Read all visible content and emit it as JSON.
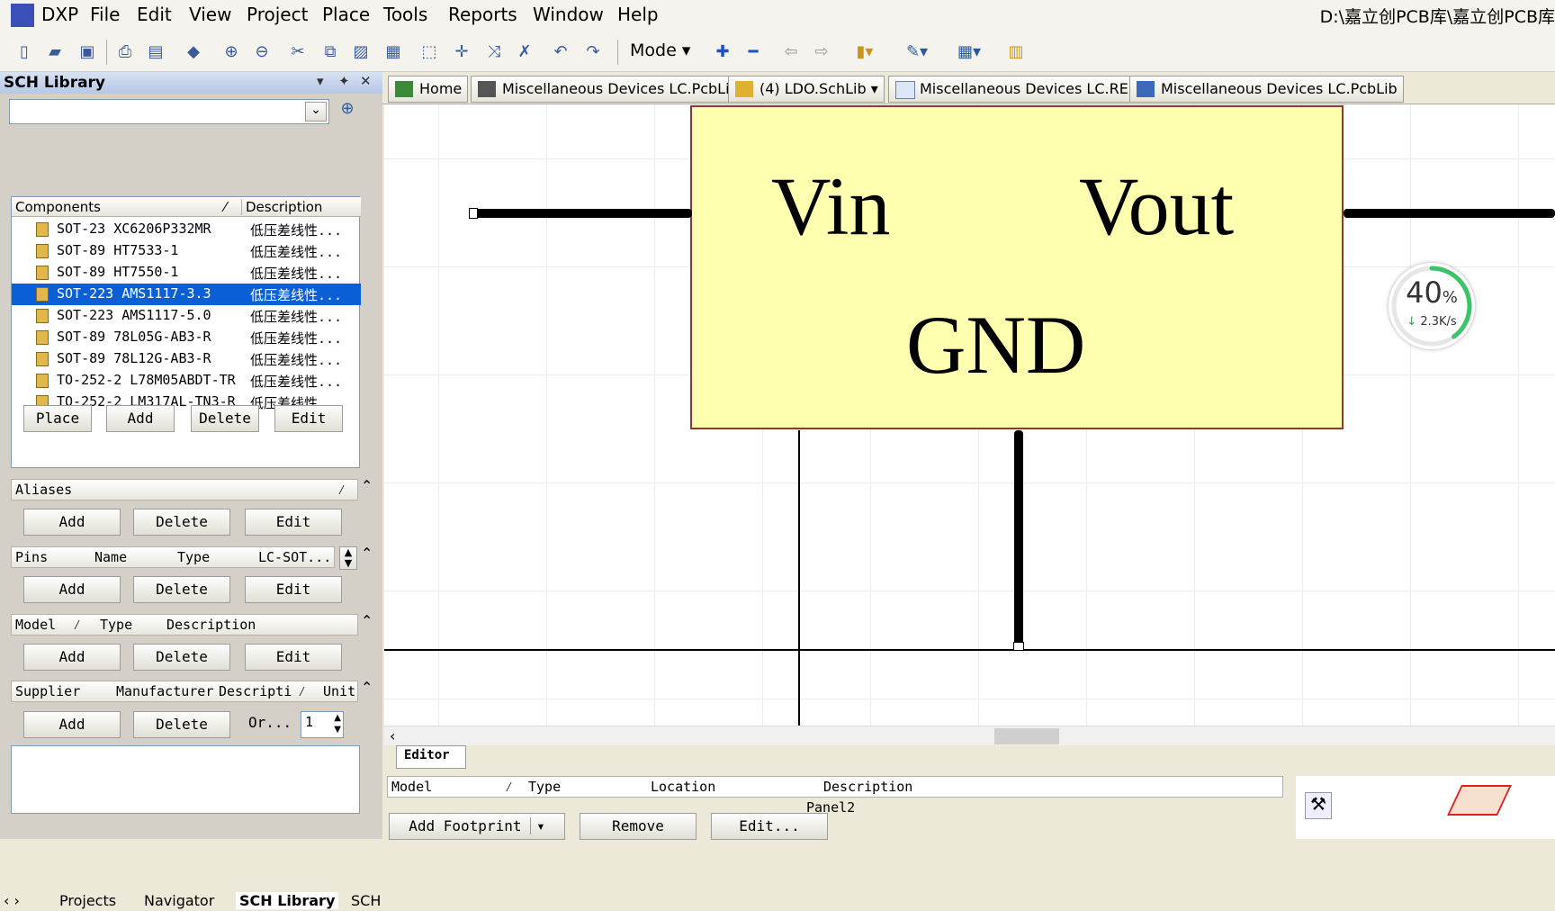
{
  "menubar": {
    "items": [
      "DXP",
      "File",
      "Edit",
      "View",
      "Project",
      "Place",
      "Tools",
      "Reports",
      "Window",
      "Help"
    ],
    "path": "D:\\嘉立创PCB库\\嘉立创PCB库"
  },
  "toolbar": {
    "mode_label": "Mode"
  },
  "panel": {
    "title": "SCH Library",
    "search_value": "",
    "components": {
      "header_name": "Components",
      "header_desc": "Description",
      "rows": [
        {
          "name": "SOT-23 XC6206P332MR",
          "desc": "低压差线性..."
        },
        {
          "name": "SOT-89 HT7533-1",
          "desc": "低压差线性..."
        },
        {
          "name": "SOT-89 HT7550-1",
          "desc": "低压差线性..."
        },
        {
          "name": "SOT-223 AMS1117-3.3",
          "desc": "低压差线性..."
        },
        {
          "name": "SOT-223 AMS1117-5.0",
          "desc": "低压差线性..."
        },
        {
          "name": "SOT-89 78L05G-AB3-R",
          "desc": "低压差线性..."
        },
        {
          "name": "SOT-89 78L12G-AB3-R",
          "desc": "低压差线性..."
        },
        {
          "name": "TO-252-2 L78M05ABDT-TR",
          "desc": "低压差线性..."
        },
        {
          "name": "TO-252-2 LM317AL-TN3-R",
          "desc": "低压差线性..."
        }
      ],
      "buttons": [
        "Place",
        "Add",
        "Delete",
        "Edit"
      ]
    },
    "aliases": {
      "header": "Aliases",
      "buttons": [
        "Add",
        "Delete",
        "Edit"
      ]
    },
    "pins": {
      "headers": [
        "Pins",
        "Name",
        "Type",
        "LC-SOT..."
      ],
      "buttons": [
        "Add",
        "Delete",
        "Edit"
      ]
    },
    "model": {
      "headers": [
        "Model",
        "Type",
        "Description"
      ],
      "buttons": [
        "Add",
        "Delete",
        "Edit"
      ]
    },
    "supplier": {
      "headers": [
        "Supplier",
        "Manufacturer",
        "Descripti",
        "Unit"
      ],
      "buttons": [
        "Add",
        "Delete"
      ],
      "order_label": "Or...",
      "order_qty": "1"
    },
    "bottom_tabs": [
      "Projects",
      "Navigator",
      "SCH Library",
      "SCH"
    ]
  },
  "doc_tabs": [
    "Home",
    "Miscellaneous Devices LC.PcbLib",
    "(4) LDO.SchLib",
    "Miscellaneous Devices LC.REP",
    "Miscellaneous Devices LC.PcbLib"
  ],
  "schematic": {
    "pin_left": "Vin",
    "pin_right": "Vout",
    "pin_bottom": "GND"
  },
  "net_widget": {
    "percent": "40",
    "percent_sign": "%",
    "speed": "2.3K/s",
    "progress": 0.4,
    "color": "#3cc46a"
  },
  "editor": {
    "tab": "Editor",
    "headers": [
      "Model",
      "Type",
      "Location",
      "Description"
    ],
    "panel_label": "Panel2",
    "buttons": [
      "Add Footprint",
      "Remove",
      "Edit..."
    ]
  }
}
